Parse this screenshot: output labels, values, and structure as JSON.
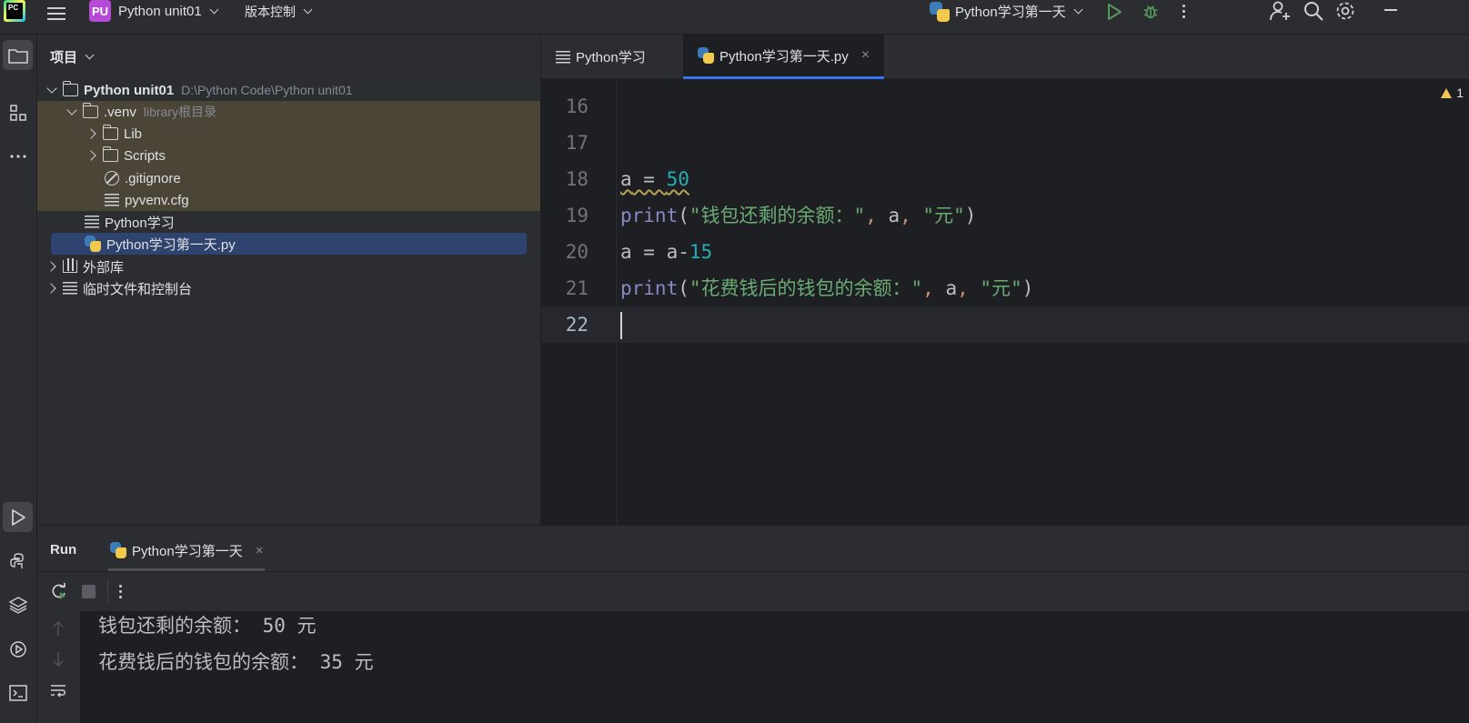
{
  "titlebar": {
    "app_logo": "PC",
    "project_badge": "PU",
    "project_name": "Python unit01",
    "vcs_label": "版本控制",
    "run_config": "Python学习第一天",
    "icons": [
      "hamburger-menu-icon",
      "run-icon",
      "debug-icon",
      "more-icon",
      "add-user-icon",
      "search-icon",
      "settings-icon",
      "minimize-icon"
    ]
  },
  "toolstrip": {
    "icons": [
      "project-folder-icon",
      "structure-icon",
      "more-tools-icon",
      "run-tool-icon",
      "python-console-icon",
      "layers-icon",
      "services-icon",
      "terminal-icon"
    ]
  },
  "project": {
    "header": "项目",
    "tree": [
      {
        "label": "Python unit01",
        "hint": "D:\\Python Code\\Python unit01",
        "icon": "folder-icon"
      },
      {
        "label": ".venv",
        "hint": "library根目录",
        "icon": "folder-icon"
      },
      {
        "label": "Lib",
        "icon": "folder-icon"
      },
      {
        "label": "Scripts",
        "icon": "folder-icon"
      },
      {
        "label": ".gitignore",
        "icon": "ignore-file-icon"
      },
      {
        "label": "pyvenv.cfg",
        "icon": "text-file-icon"
      },
      {
        "label": "Python学习",
        "icon": "text-file-icon"
      },
      {
        "label": "Python学习第一天.py",
        "icon": "python-file-icon"
      },
      {
        "label": "外部库",
        "icon": "library-icon"
      },
      {
        "label": "临时文件和控制台",
        "icon": "scratch-icon"
      }
    ]
  },
  "editor": {
    "tabs": [
      {
        "label": "Python学习"
      },
      {
        "label": "Python学习第一天.py",
        "active": true,
        "close": "×"
      }
    ],
    "warning_count": "1",
    "line_numbers": [
      "16",
      "17",
      "18",
      "19",
      "20",
      "21",
      "22"
    ],
    "code": {
      "l18_var": "a",
      "l18_eq": " = ",
      "l18_num": "50",
      "l19_fn": "print",
      "l19_open": "(",
      "l19_str1": "\"钱包还剩的余额：\"",
      "l19_comma1": ", ",
      "l19_var": "a",
      "l19_comma2": ", ",
      "l19_str2": "\"元\"",
      "l19_close": ")",
      "l20_lhs": "a = a-",
      "l20_num": "15",
      "l21_fn": "print",
      "l21_open": "(",
      "l21_str1": "\"花费钱后的钱包的余额：\"",
      "l21_comma1": ", ",
      "l21_var": "a",
      "l21_comma2": ", ",
      "l21_str2": "\"元\"",
      "l21_close": ")"
    }
  },
  "run": {
    "title": "Run",
    "tab_label": "Python学习第一天",
    "tab_close": "×",
    "output": [
      "钱包还剩的余额： 50 元",
      "花费钱后的钱包的余额： 35 元"
    ]
  },
  "colors": {
    "accent": "#3574f0",
    "string": "#6aab73",
    "number": "#2aacb8",
    "builtin": "#8888c6",
    "project_badge": "#b54ad4",
    "venv_highlight": "#4b4537",
    "selection": "#2e436e"
  }
}
